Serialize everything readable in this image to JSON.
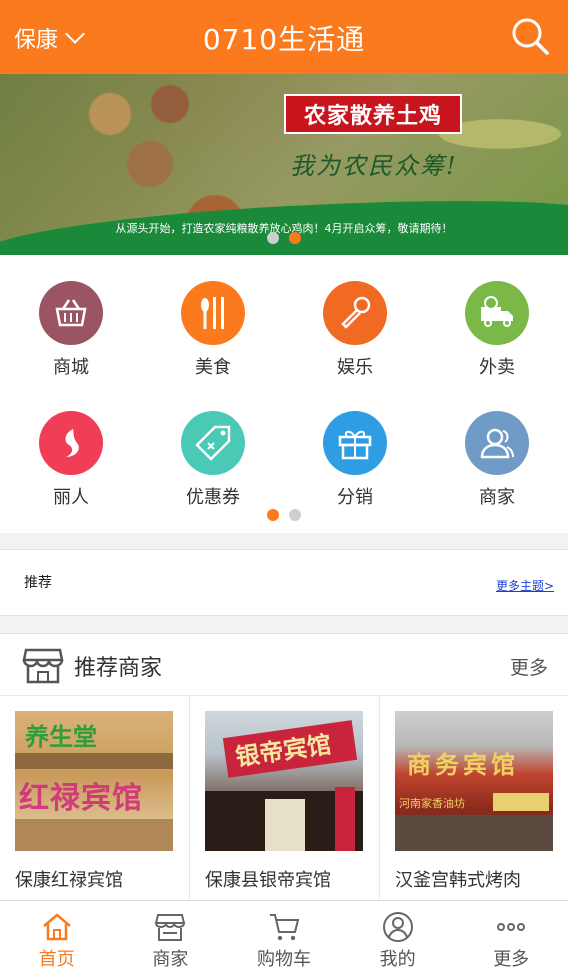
{
  "header": {
    "city": "保康",
    "title": "0710生活通"
  },
  "banner": {
    "headline": "农家散养土鸡",
    "slogan": "我为农民众筹!",
    "tagline": "从源头开始，打造农家纯粮散养放心鸡肉！4月开启众筹，敬请期待！",
    "page_count": 2,
    "active_page": 2
  },
  "categories": [
    {
      "label": "商城",
      "icon": "basket-icon",
      "color": "#9b5462"
    },
    {
      "label": "美食",
      "icon": "utensils-icon",
      "color": "#fb7a1e"
    },
    {
      "label": "娱乐",
      "icon": "microphone-icon",
      "color": "#f06a24"
    },
    {
      "label": "外卖",
      "icon": "delivery-truck-icon",
      "color": "#7ab848"
    },
    {
      "label": "丽人",
      "icon": "beauty-icon",
      "color": "#ef3e55"
    },
    {
      "label": "优惠券",
      "icon": "coupon-tag-icon",
      "color": "#4ac9b6"
    },
    {
      "label": "分销",
      "icon": "gift-icon",
      "color": "#2f9de3"
    },
    {
      "label": "商家",
      "icon": "users-icon",
      "color": "#6f9bc6"
    }
  ],
  "grid_pages": {
    "count": 2,
    "active": 1
  },
  "recommend": {
    "title": "推荐",
    "more": "更多主题>"
  },
  "merchants": {
    "title": "推荐商家",
    "more": "更多",
    "items": [
      {
        "name": "保康红禄宾馆",
        "sign": "红禄宾馆",
        "sign_top": "养生堂"
      },
      {
        "name": "保康县银帝宾馆",
        "sign": "银帝宾馆"
      },
      {
        "name": "汉釜宫韩式烤肉",
        "sign": "商务宾馆",
        "sign_sub": "河南家香油坊"
      }
    ]
  },
  "tabbar": {
    "items": [
      {
        "label": "首页",
        "icon": "home-icon",
        "active": true
      },
      {
        "label": "商家",
        "icon": "store-icon",
        "active": false
      },
      {
        "label": "购物车",
        "icon": "cart-icon",
        "active": false
      },
      {
        "label": "我的",
        "icon": "user-icon",
        "active": false
      },
      {
        "label": "更多",
        "icon": "more-dots-icon",
        "active": false
      }
    ]
  },
  "colors": {
    "brand": "#fb7a1e",
    "link": "#1a3fd0"
  }
}
